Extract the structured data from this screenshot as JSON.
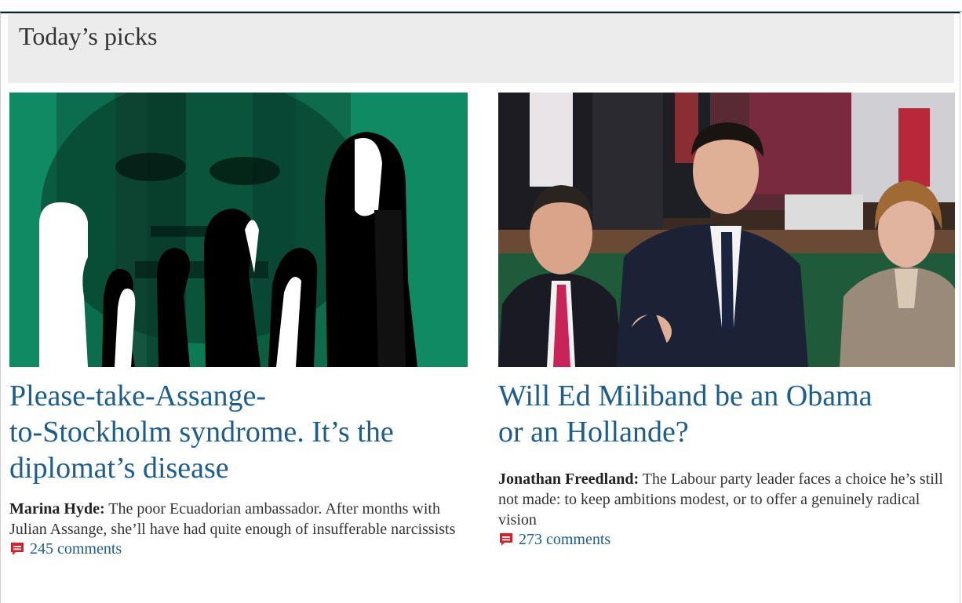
{
  "section": {
    "title": "Today’s picks"
  },
  "articles": [
    {
      "image_alt": "Illustration of Julian Assange's face in green strips with black and white silhouettes of people",
      "headline": "Please-take-Assange-to-Stockholm syndrome. It’s the diplomat’s disease",
      "headline_lines": [
        "Please-take-Assange-",
        "to-Stockholm syndrome. It’s the",
        "diplomat’s disease"
      ],
      "byline": "Marina Hyde:",
      "standfirst": "The poor Ecuadorian ambassador. After months with Julian Assange, she’ll have had quite enough of insufferable narcissists",
      "comments": "245 comments",
      "comment_icon": "speech-bubble-icon"
    },
    {
      "image_alt": "Ed Miliband pointing in the House of Commons with MPs seated around him",
      "headline": "Will Ed Miliband be an Obama or an Hollande?",
      "headline_lines": [
        "Will Ed Miliband be an Obama",
        "or an Hollande?"
      ],
      "byline": "Jonathan Freedland:",
      "standfirst": "The Labour party leader faces a choice he’s still not made: to keep ambitions modest, or to offer a genuinely radical vision",
      "comments": "273 comments",
      "comment_icon": "speech-bubble-icon"
    }
  ],
  "colors": {
    "link": "#1d5d8d",
    "header_bg": "#ececec",
    "comment_icon": "#d2232a",
    "illustration_green": "#0f8a63"
  }
}
